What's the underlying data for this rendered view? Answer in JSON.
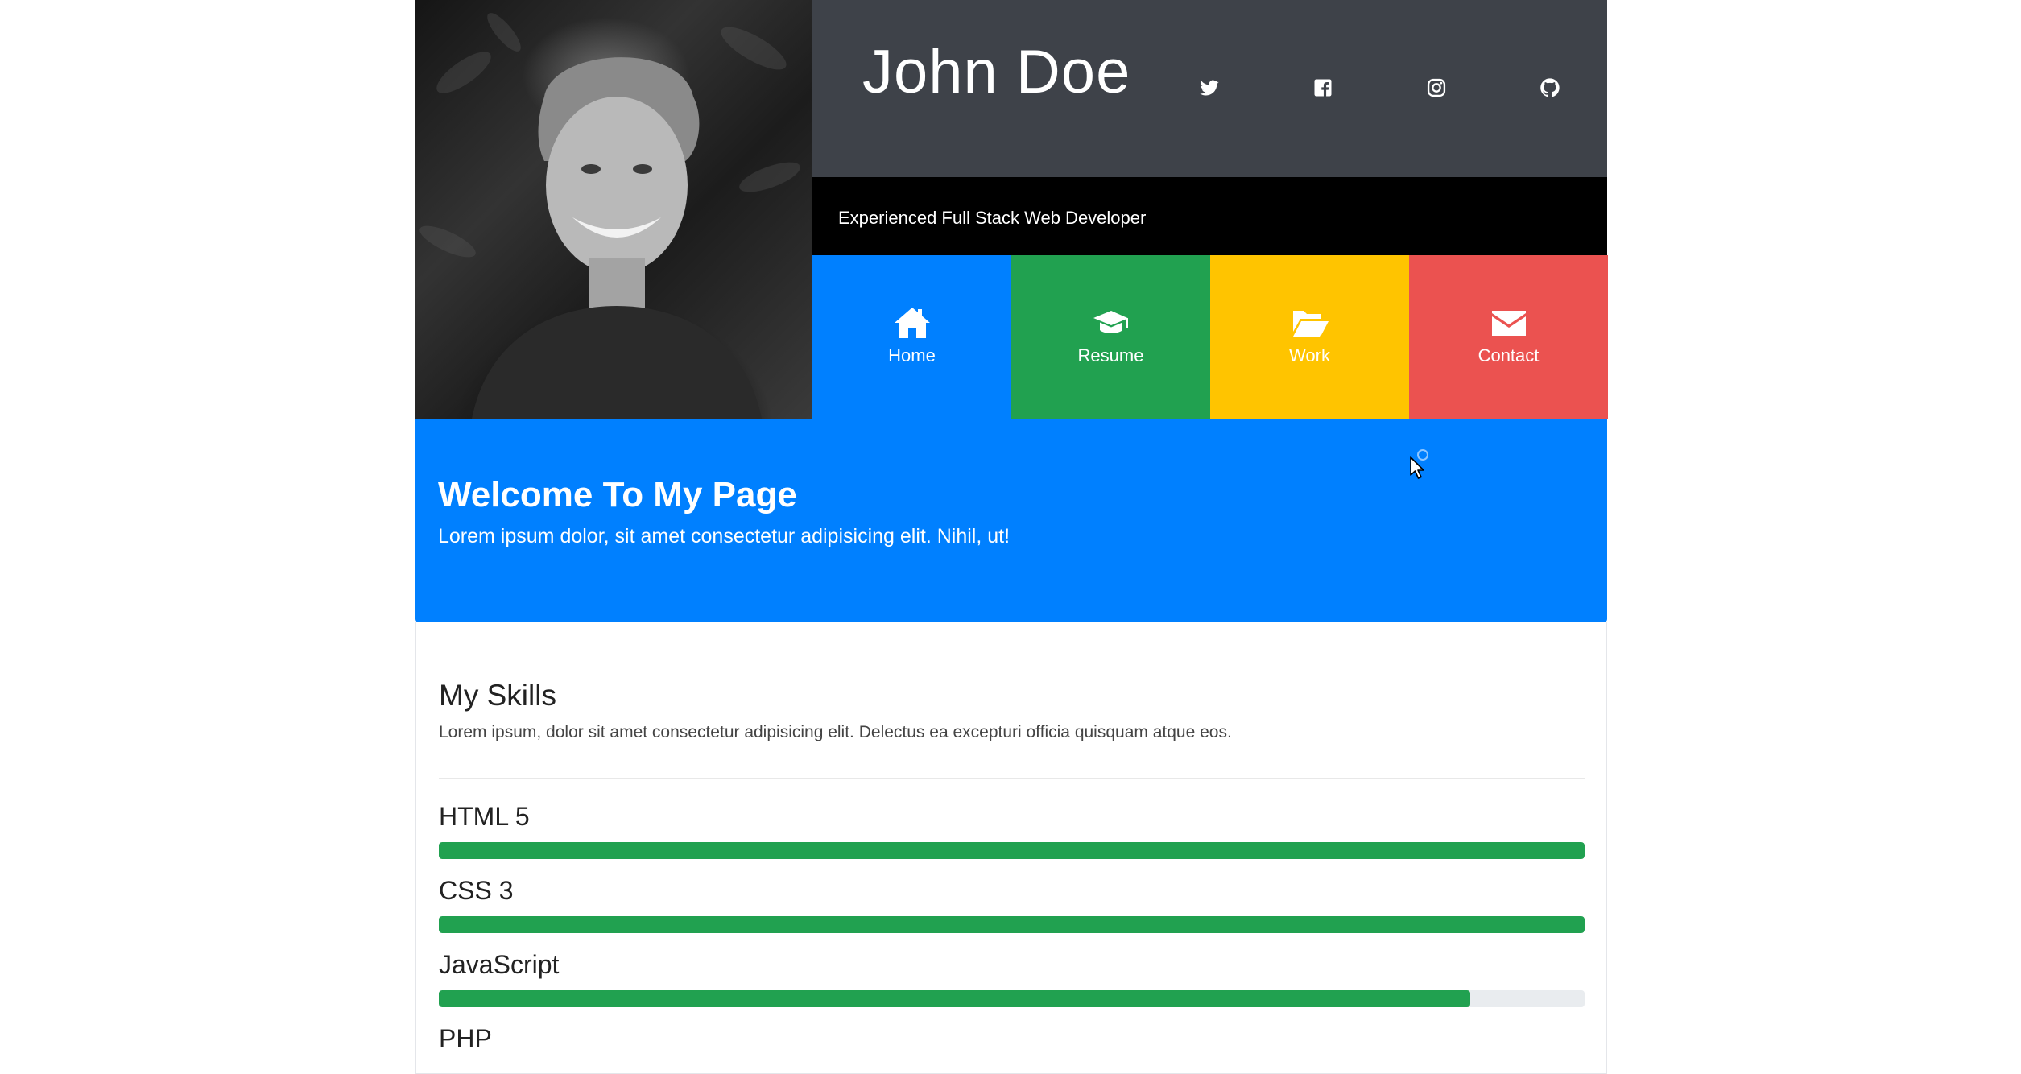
{
  "header": {
    "name": "John Doe",
    "tagline": "Experienced Full Stack Web Developer",
    "social": [
      {
        "icon": "twitter-icon"
      },
      {
        "icon": "facebook-icon"
      },
      {
        "icon": "instagram-icon"
      },
      {
        "icon": "github-icon"
      }
    ],
    "colors": {
      "name_bar": "#3e4249",
      "tagline_bar": "#000000"
    }
  },
  "nav": {
    "tiles": [
      {
        "label": "Home",
        "icon": "home-icon",
        "color": "#0080ff"
      },
      {
        "label": "Resume",
        "icon": "graduation-cap-icon",
        "color": "#21a150"
      },
      {
        "label": "Work",
        "icon": "folder-open-icon",
        "color": "#ffc400"
      },
      {
        "label": "Contact",
        "icon": "envelope-icon",
        "color": "#eb5250"
      }
    ]
  },
  "welcome": {
    "title": "Welcome To My Page",
    "text": "Lorem ipsum dolor, sit amet consectetur adipisicing elit. Nihil, ut!",
    "color": "#0080ff"
  },
  "skills": {
    "title": "My Skills",
    "intro": "Lorem ipsum, dolor sit amet consectetur adipisicing elit. Delectus ea excepturi officia quisquam atque eos.",
    "bar_color": "#21a150",
    "items": [
      {
        "name": "HTML 5",
        "level": 100
      },
      {
        "name": "CSS 3",
        "level": 100
      },
      {
        "name": "JavaScript",
        "level": 90
      },
      {
        "name": "PHP"
      }
    ]
  }
}
